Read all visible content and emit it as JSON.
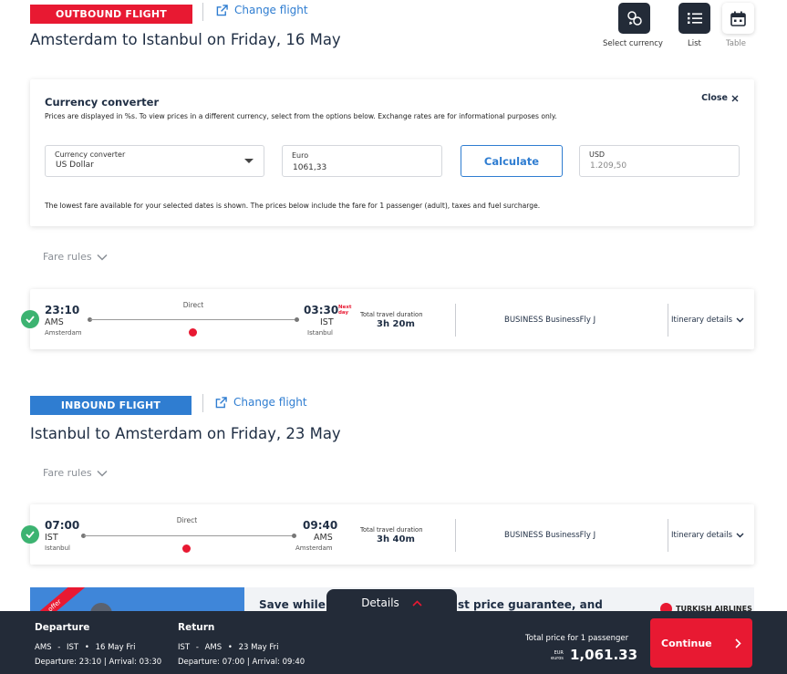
{
  "outbound": {
    "badge": "OUTBOUND FLIGHT",
    "change_link": "Change flight",
    "title": "Amsterdam to Istanbul on Friday, 16 May",
    "fare_rules": "Fare rules",
    "flight": {
      "dep_time": "23:10",
      "dep_code": "AMS",
      "dep_city": "Amsterdam",
      "arr_time": "03:30",
      "arr_code": "IST",
      "arr_city": "Istanbul",
      "next_day_line1": "Next",
      "next_day_line2": "day",
      "stop_type": "Direct",
      "duration_label": "Total travel duration",
      "duration": "3h 20m",
      "cabin": "BUSINESS BusinessFly J",
      "itinerary_link": "Itinerary details"
    }
  },
  "view_options": {
    "currency": "Select currency",
    "list": "List",
    "table": "Table"
  },
  "converter": {
    "title": "Currency converter",
    "subtitle": "Prices are displayed in %s. To view prices in a different currency, select from the options below. Exchange rates are for informational purposes only.",
    "close": "Close",
    "currency_label": "Currency converter",
    "currency_value": "US Dollar",
    "from_label": "Euro",
    "from_value": "1061,33",
    "calculate": "Calculate",
    "to_label": "USD",
    "to_value": "1.209,50",
    "note": "The lowest fare available for your selected dates is shown. The prices below include the fare for 1 passenger (adult), taxes and fuel surcharge."
  },
  "inbound": {
    "badge": "INBOUND FLIGHT",
    "change_link": "Change flight",
    "title": "Istanbul to Amsterdam on Friday, 23 May",
    "fare_rules": "Fare rules",
    "flight": {
      "dep_time": "07:00",
      "dep_code": "IST",
      "dep_city": "Istanbul",
      "arr_time": "09:40",
      "arr_code": "AMS",
      "arr_city": "Amsterdam",
      "stop_type": "Direct",
      "duration_label": "Total travel duration",
      "duration": "3h 40m",
      "cabin": "BUSINESS BusinessFly J",
      "itinerary_link": "Itinerary details"
    }
  },
  "promo": {
    "ribbon": "offer",
    "text_left": "Save while e",
    "text_right": "st price guarantee, and",
    "logo": "TURKISH AIRLINES"
  },
  "bottom": {
    "details_tab": "Details",
    "departure": {
      "heading": "Departure",
      "from": "AMS",
      "dash": "-",
      "to": "IST",
      "bullet": "•",
      "date": "16 May Fri",
      "times": "Departure: 23:10 | Arrival: 03:30"
    },
    "return": {
      "heading": "Return",
      "from": "IST",
      "dash": "-",
      "to": "AMS",
      "bullet": "•",
      "date": "23 May Fri",
      "times": "Departure: 07:00 | Arrival: 09:40"
    },
    "total_label": "Total price for 1 passenger",
    "currency_code": "EUR",
    "currency_word": "euros",
    "total": "1,061.33",
    "continue": "Continue"
  },
  "colors": {
    "brand_red": "#e81932",
    "inbound_blue": "#2f7dd1",
    "dark_bar": "#232b38",
    "success_green": "#3cb371"
  }
}
